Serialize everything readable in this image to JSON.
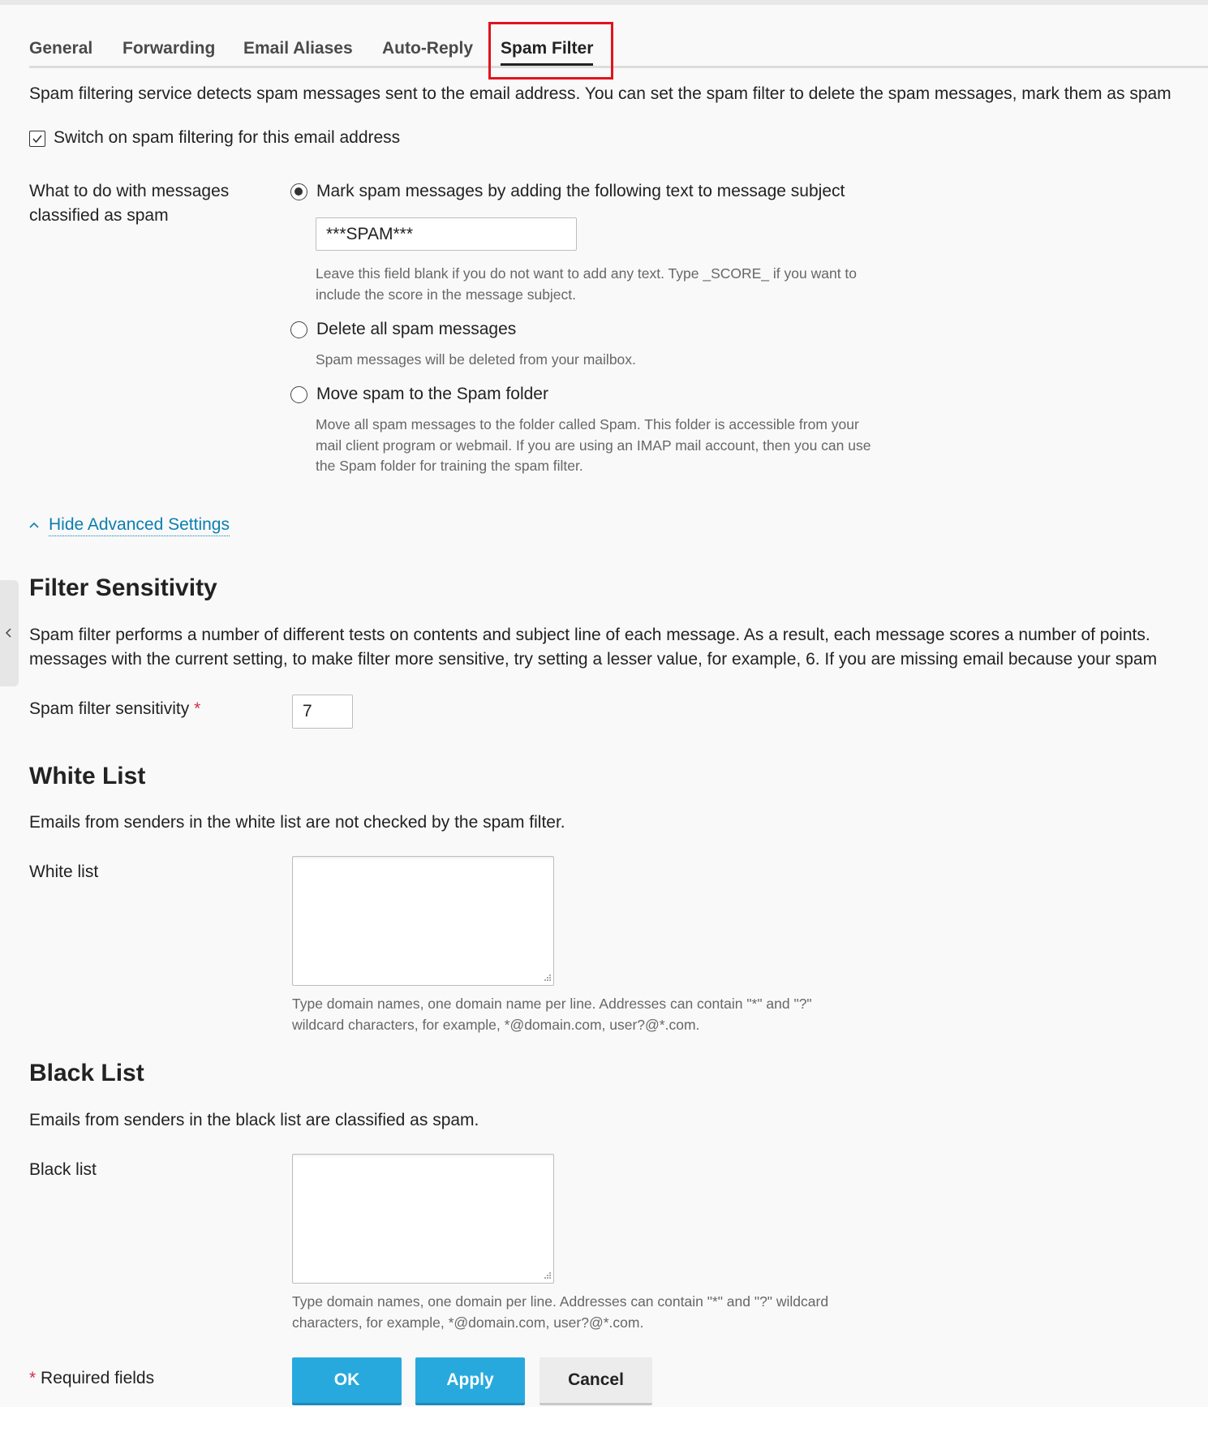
{
  "tabs": [
    {
      "label": "General",
      "active": false
    },
    {
      "label": "Forwarding",
      "active": false
    },
    {
      "label": "Email Aliases",
      "active": false
    },
    {
      "label": "Auto-Reply",
      "active": false
    },
    {
      "label": "Spam Filter",
      "active": true
    }
  ],
  "intro_text": "Spam filtering service detects spam messages sent to the email address. You can set the spam filter to delete the spam messages, mark them as spam",
  "enable_checkbox": {
    "label": "Switch on spam filtering for this email address",
    "checked": true
  },
  "action": {
    "label_line1": "What to do with messages",
    "label_line2": "classified as spam",
    "options": [
      {
        "label": "Mark spam messages by adding the following text to message subject",
        "checked": true,
        "hint_line1": "Leave this field blank if you do not want to add any text. Type _SCORE_ if you want to",
        "hint_line2": "include the score in the message subject."
      },
      {
        "label": "Delete all spam messages",
        "checked": false,
        "hint_line1": "Spam messages will be deleted from your mailbox."
      },
      {
        "label": "Move spam to the Spam folder",
        "checked": false,
        "hint_line1": "Move all spam messages to the folder called Spam. This folder is accessible from your",
        "hint_line2": "mail client program or webmail. If you are using an IMAP mail account, then you can use",
        "hint_line3": "the Spam folder for training the spam filter."
      }
    ],
    "subject_text_value": "***SPAM***"
  },
  "advanced_toggle": {
    "label": "Hide Advanced Settings"
  },
  "filter_sensitivity": {
    "heading": "Filter Sensitivity",
    "desc_line1": "Spam filter performs a number of different tests on contents and subject line of each message. As a result, each message scores a number of points.",
    "desc_line2": "messages with the current setting, to make filter more sensitive, try setting a lesser value, for example, 6. If you are missing email because your spam",
    "field_label": "Spam filter sensitivity",
    "required_mark": "*",
    "value": "7"
  },
  "white_list": {
    "heading": "White List",
    "desc": "Emails from senders in the white list are not checked by the spam filter.",
    "field_label": "White list",
    "value": "",
    "hint_line1": "Type domain names, one domain name per line. Addresses can contain \"*\" and \"?\"",
    "hint_line2": "wildcard characters, for example, *@domain.com, user?@*.com."
  },
  "black_list": {
    "heading": "Black List",
    "desc": "Emails from senders in the black list are classified as spam.",
    "field_label": "Black list",
    "value": "",
    "hint_line1": "Type domain names, one domain per line. Addresses can contain \"*\" and \"?\" wildcard",
    "hint_line2": "characters, for example, *@domain.com, user?@*.com."
  },
  "footer": {
    "required_mark": "*",
    "required_text": "Required fields",
    "ok_label": "OK",
    "apply_label": "Apply",
    "cancel_label": "Cancel"
  },
  "colors": {
    "primary_button": "#28a9dd",
    "link": "#0a7fb0",
    "required_star": "#d0304b",
    "highlight_box": "#e0141e"
  }
}
